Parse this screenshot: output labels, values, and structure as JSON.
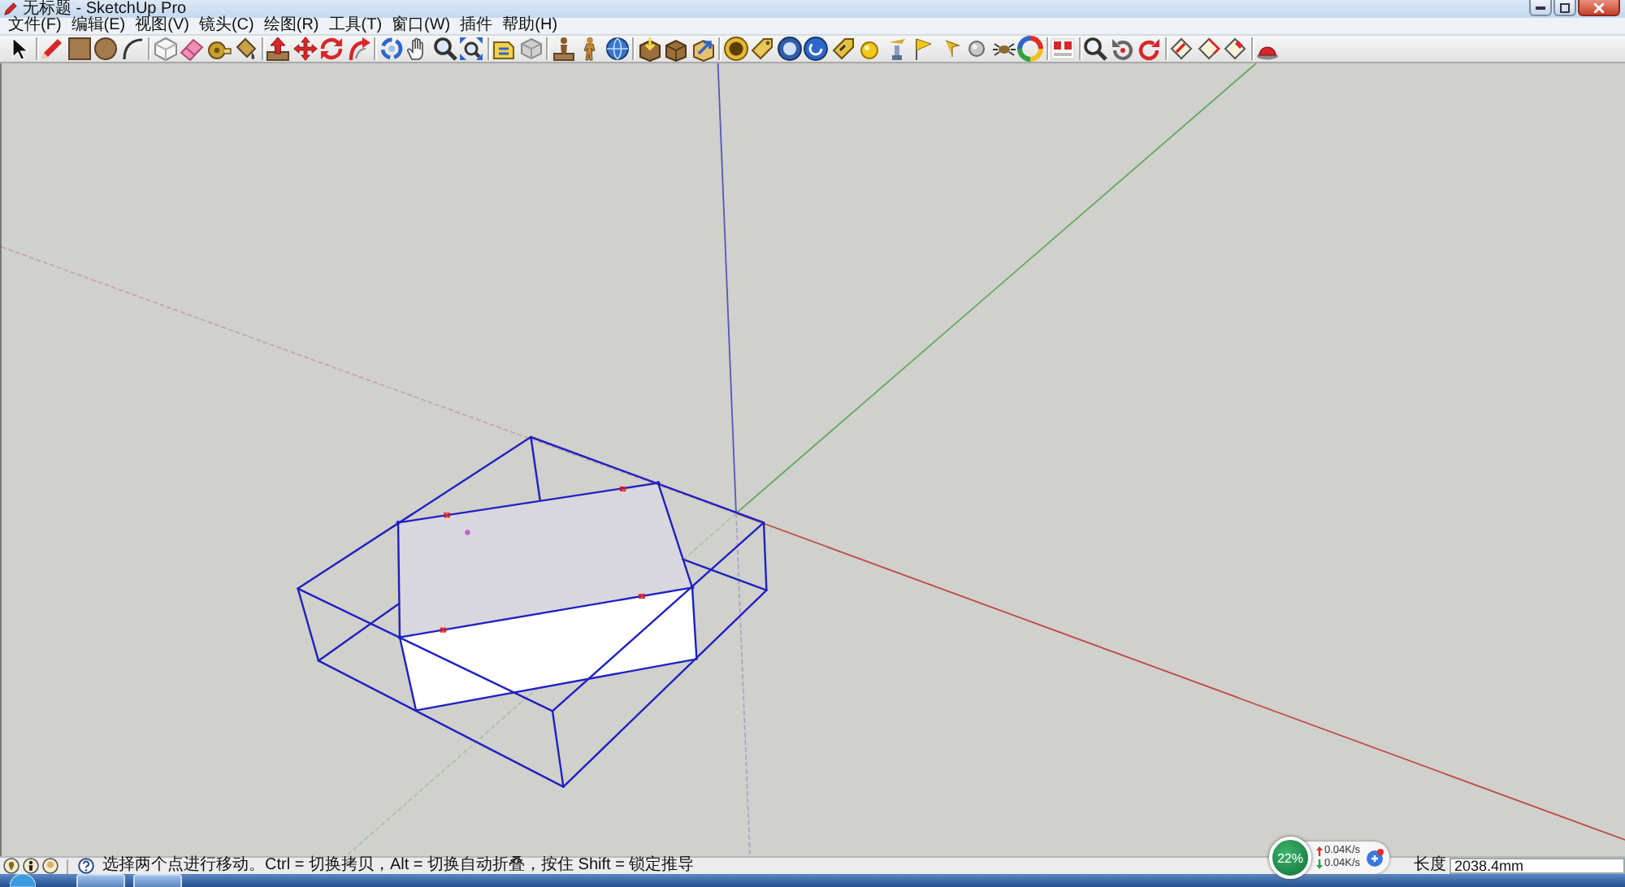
{
  "window": {
    "title": "无标题 - SketchUp Pro"
  },
  "menu": [
    "文件(F)",
    "编辑(E)",
    "视图(V)",
    "镜头(C)",
    "绘图(R)",
    "工具(T)",
    "窗口(W)",
    "插件",
    "帮助(H)"
  ],
  "status_bar": {
    "hint": "选择两个点进行移动。Ctrl = 切换拷贝，Alt = 切换自动折叠，按住 Shift = 锁定推导",
    "measurement": {
      "label": "长度",
      "value": "2038.4mm"
    }
  },
  "speed_widget": {
    "percent": "22%",
    "upload": "0.04K/s",
    "download": "0.04K/s"
  }
}
